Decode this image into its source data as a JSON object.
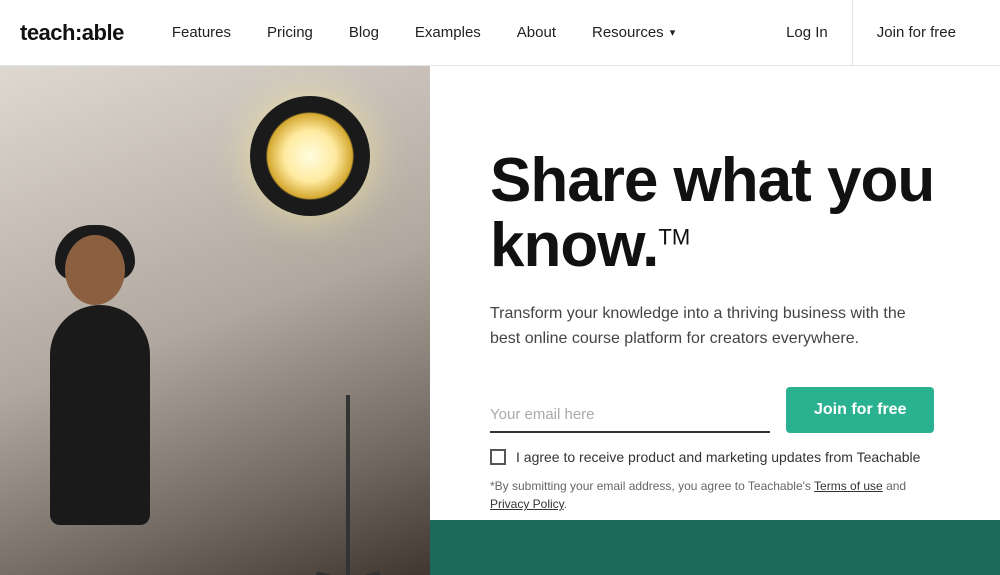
{
  "brand": {
    "logo": "teach:able",
    "logo_colon_color": "#111"
  },
  "nav": {
    "links": [
      {
        "id": "features",
        "label": "Features"
      },
      {
        "id": "pricing",
        "label": "Pricing"
      },
      {
        "id": "blog",
        "label": "Blog"
      },
      {
        "id": "examples",
        "label": "Examples"
      },
      {
        "id": "about",
        "label": "About"
      },
      {
        "id": "resources",
        "label": "Resources",
        "has_dropdown": true
      }
    ],
    "login_label": "Log In",
    "join_label": "Join for free"
  },
  "hero": {
    "title_line1": "Share what you",
    "title_line2": "know.",
    "title_trademark": "TM",
    "subtitle": "Transform your knowledge into a thriving business with the best online course platform for creators everywhere.",
    "email_placeholder": "Your email here",
    "cta_button": "Join for free",
    "checkbox_label": "I agree to receive product and marketing updates from Teachable",
    "legal_prefix": "*By submitting your email address, you agree to Teachable's ",
    "terms_label": "Terms of use",
    "legal_and": " and ",
    "privacy_label": "Privacy Policy",
    "legal_suffix": "."
  },
  "colors": {
    "accent": "#2ab190",
    "nav_border": "#e5e5e5",
    "bottom_strip": "#1a6b5a"
  }
}
